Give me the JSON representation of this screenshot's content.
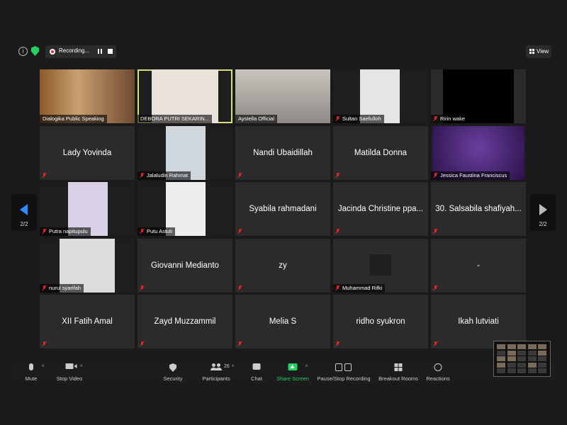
{
  "topbar": {
    "recording_label": "Recording...",
    "view_label": "View"
  },
  "pager": {
    "left_label": "2/2",
    "right_label": "2/2"
  },
  "tiles": [
    {
      "label": "Dialogika Public Speaking",
      "name": "",
      "video": true,
      "muted": false
    },
    {
      "label": "DEBORA PUTRI SEKARIN...",
      "name": "",
      "video": true,
      "muted": false,
      "active": true
    },
    {
      "label": "Aystella Official",
      "name": "",
      "video": true,
      "muted": false
    },
    {
      "label": "Sultan Saefulloh",
      "name": "",
      "video": true,
      "muted": true
    },
    {
      "label": "Ririn wake",
      "name": "",
      "video": true,
      "muted": true
    },
    {
      "label": "",
      "name": "Lady Yovinda",
      "video": false,
      "muted": true
    },
    {
      "label": "Jalaludin Rahmat",
      "name": "",
      "video": true,
      "muted": true
    },
    {
      "label": "",
      "name": "Nandi Ubaidillah",
      "video": false,
      "muted": true
    },
    {
      "label": "",
      "name": "Matilda Donna",
      "video": false,
      "muted": true
    },
    {
      "label": "Jessica Faustina Franciscus",
      "name": "",
      "video": true,
      "muted": true
    },
    {
      "label": "Putra napitupulu",
      "name": "",
      "video": true,
      "muted": true
    },
    {
      "label": "Putu Astuti",
      "name": "",
      "video": true,
      "muted": true
    },
    {
      "label": "",
      "name": "Syabila rahmadani",
      "video": false,
      "muted": true
    },
    {
      "label": "",
      "name": "Jacinda Christine ppa...",
      "video": false,
      "muted": true
    },
    {
      "label": "",
      "name": "30. Salsabila shafiyah...",
      "video": false,
      "muted": true
    },
    {
      "label": "nurul syarifah",
      "name": "",
      "video": true,
      "muted": true
    },
    {
      "label": "",
      "name": "Giovanni Medianto",
      "video": false,
      "muted": true
    },
    {
      "label": "",
      "name": "zy",
      "video": false,
      "muted": true
    },
    {
      "label": "Muhammad Rifki",
      "name": "",
      "video": true,
      "muted": true
    },
    {
      "label": "",
      "name": "-",
      "video": false,
      "muted": true
    },
    {
      "label": "",
      "name": "XII Fatih Amal",
      "video": false,
      "muted": true
    },
    {
      "label": "",
      "name": "Zayd Muzzammil",
      "video": false,
      "muted": true
    },
    {
      "label": "",
      "name": "Melia S",
      "video": false,
      "muted": true
    },
    {
      "label": "",
      "name": "ridho syukron",
      "video": false,
      "muted": true
    },
    {
      "label": "",
      "name": "Ikah lutviati",
      "video": false,
      "muted": true
    }
  ],
  "toolbar": {
    "mute_label": "Mute",
    "stop_video_label": "Stop Video",
    "security_label": "Security",
    "participants_label": "Participants",
    "participants_count": "26",
    "chat_label": "Chat",
    "share_screen_label": "Share Screen",
    "record_label": "Pause/Stop Recording",
    "breakout_label": "Breakout Rooms",
    "reactions_label": "Reactions"
  },
  "colors": {
    "accent_blue": "#2d8cff",
    "share_green": "#23d160",
    "active_speaker": "#d6e07a",
    "muted_red": "#e02828"
  }
}
